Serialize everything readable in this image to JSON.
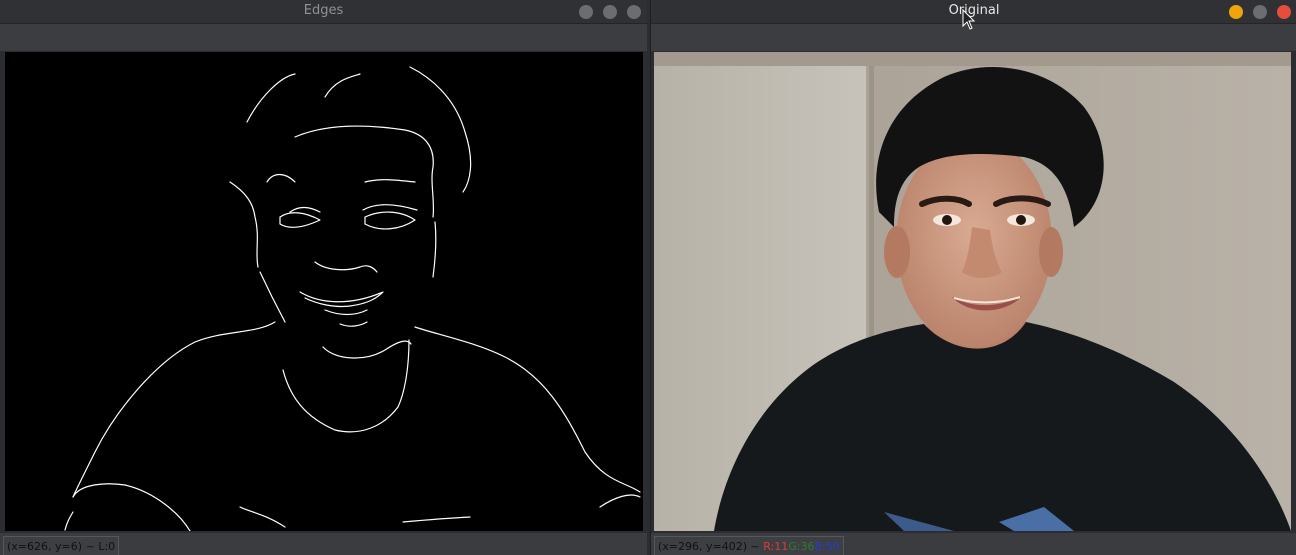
{
  "windows": {
    "edges": {
      "title": "Edges",
      "status": "(x=626, y=6) ~ L:0"
    },
    "original": {
      "title": "Original",
      "status_prefix": "(x=296, y=402) ~",
      "status_r": "R:11",
      "status_g": "G:36",
      "status_b": "B:50"
    }
  },
  "colors": {
    "minimize": "#f0a30a",
    "maximize": "#6b6d70",
    "close": "#e74c3c",
    "status_r": "#e53935",
    "status_g": "#2e7d32",
    "status_b": "#1e3fd8"
  },
  "icons": {
    "window_buttons": [
      "minimize-icon",
      "maximize-icon",
      "close-icon"
    ],
    "pointer": "mouse-cursor-icon"
  }
}
